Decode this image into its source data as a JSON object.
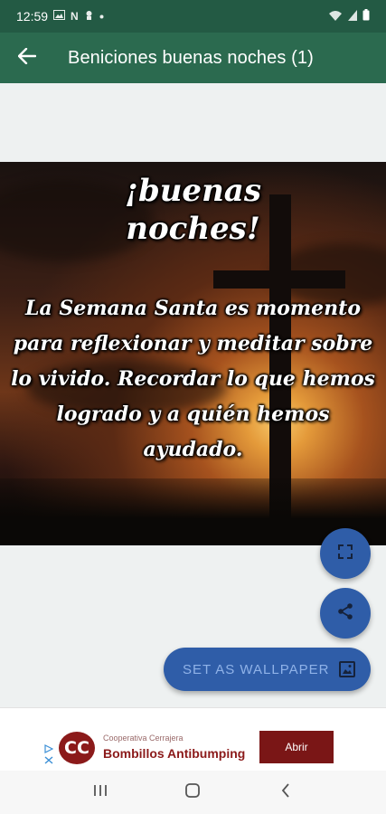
{
  "status_bar": {
    "time": "12:59",
    "icons": [
      "image-icon",
      "n-icon",
      "notification-icon",
      "dot-icon"
    ],
    "right_icons": [
      "wifi-icon",
      "signal-icon",
      "battery-icon"
    ]
  },
  "app_bar": {
    "title": "Beniciones buenas noches (1)",
    "back_icon": "arrow-left-icon"
  },
  "image": {
    "title_lines": [
      "¡buenas",
      "noches!"
    ],
    "body": "La Semana Santa es momento para reflexionar y meditar sobre lo vivido. Recordar lo que hemos logrado y a quién hemos ayudado."
  },
  "actions": {
    "expand_icon": "fullscreen-icon",
    "share_icon": "share-icon",
    "wallpaper_label": "SET AS WALLPAPER",
    "wallpaper_icon": "wallpaper-icon"
  },
  "ad": {
    "logo_text": "CC",
    "subtitle": "Cooperativa Cerrajera",
    "headline": "Bombillos Antibumping",
    "cta": "Abrir"
  },
  "nav_bar": {
    "icons": [
      "recents-icon",
      "home-icon",
      "back-icon"
    ]
  },
  "colors": {
    "app_bar": "#2b6a4f",
    "status_bar": "#235a44",
    "fab": "#2f5da8",
    "ad_brand": "#8b1a1a"
  }
}
